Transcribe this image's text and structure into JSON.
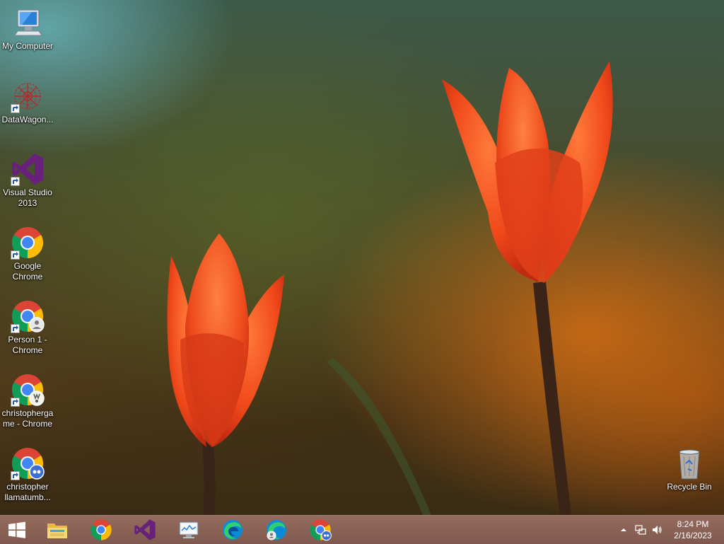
{
  "desktop": {
    "icons": [
      {
        "label": "My Computer",
        "icon": "computer-icon"
      },
      {
        "label": "DataWagon...",
        "icon": "datawagon-icon"
      },
      {
        "label": "Visual Studio 2013",
        "icon": "visual-studio-icon"
      },
      {
        "label": "Google Chrome",
        "icon": "chrome-icon"
      },
      {
        "label": "Person 1 - Chrome",
        "icon": "chrome-profile-icon"
      },
      {
        "label": "christopherga me - Chrome",
        "icon": "chrome-profile-icon"
      },
      {
        "label": "christopher llamatumb...",
        "icon": "chrome-profile-icon"
      }
    ],
    "recycle_bin": {
      "label": "Recycle Bin",
      "icon": "recycle-bin-icon"
    }
  },
  "taskbar": {
    "start": "windows-logo-icon",
    "pinned": [
      {
        "name": "file-explorer",
        "icon": "folder-icon"
      },
      {
        "name": "google-chrome",
        "icon": "chrome-icon"
      },
      {
        "name": "visual-studio",
        "icon": "visual-studio-icon"
      },
      {
        "name": "system-monitor",
        "icon": "monitor-icon"
      },
      {
        "name": "microsoft-edge",
        "icon": "edge-icon"
      },
      {
        "name": "edge-profile",
        "icon": "edge-profile-icon"
      },
      {
        "name": "chrome-profile",
        "icon": "chrome-profile-icon"
      }
    ],
    "tray": {
      "icons": [
        "show-hidden-icons-icon",
        "network-icon",
        "volume-icon"
      ],
      "time": "8:24 PM",
      "date": "2/16/2023"
    }
  },
  "colors": {
    "accent": "#f04a1a",
    "taskbar": "#87604f",
    "vs_purple": "#68217a"
  }
}
